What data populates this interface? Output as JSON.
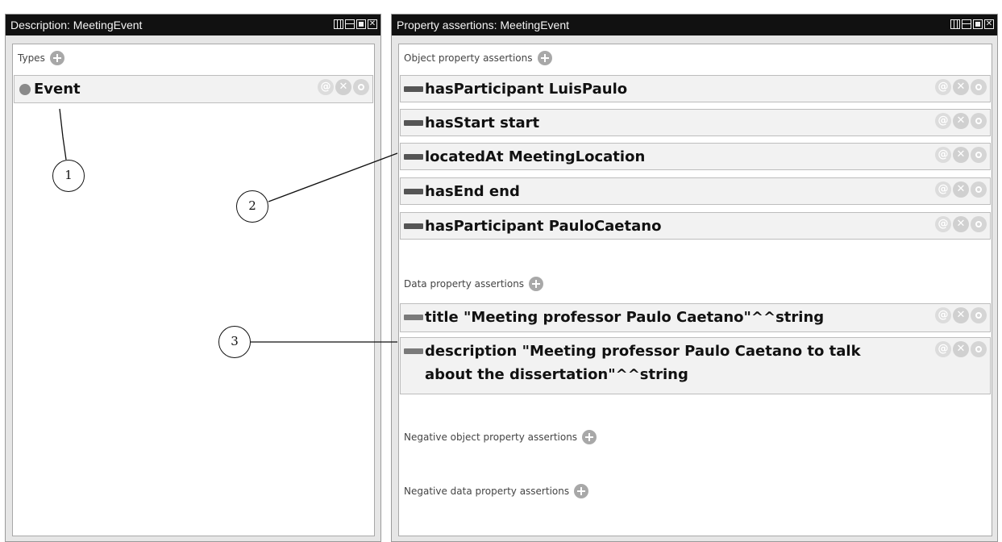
{
  "left_panel": {
    "title": "Description: MeetingEvent",
    "types_label": "Types",
    "types": [
      {
        "label": "Event"
      }
    ]
  },
  "right_panel": {
    "title": "Property assertions: MeetingEvent",
    "object_section_label": "Object property assertions",
    "object_assertions": [
      {
        "label": "hasParticipant  LuisPaulo"
      },
      {
        "label": "hasStart  start"
      },
      {
        "label": "locatedAt  MeetingLocation"
      },
      {
        "label": "hasEnd  end"
      },
      {
        "label": "hasParticipant  PauloCaetano"
      }
    ],
    "data_section_label": "Data property assertions",
    "data_assertions": [
      {
        "label": "title  \"Meeting professor Paulo Caetano\"^^string"
      },
      {
        "label": "description  \"Meeting professor Paulo Caetano to talk about the dissertation\"^^string"
      }
    ],
    "negative_object_label": "Negative object property assertions",
    "negative_data_label": "Negative data property assertions"
  },
  "row_actions": {
    "annotate": "@",
    "delete": "✕"
  },
  "window_close_glyph": "✕",
  "callouts": [
    "1",
    "2",
    "3"
  ],
  "colors": {
    "titlebar": "#111111",
    "panel_bg": "#e6e6e6",
    "row_bg": "#f2f2f2"
  }
}
